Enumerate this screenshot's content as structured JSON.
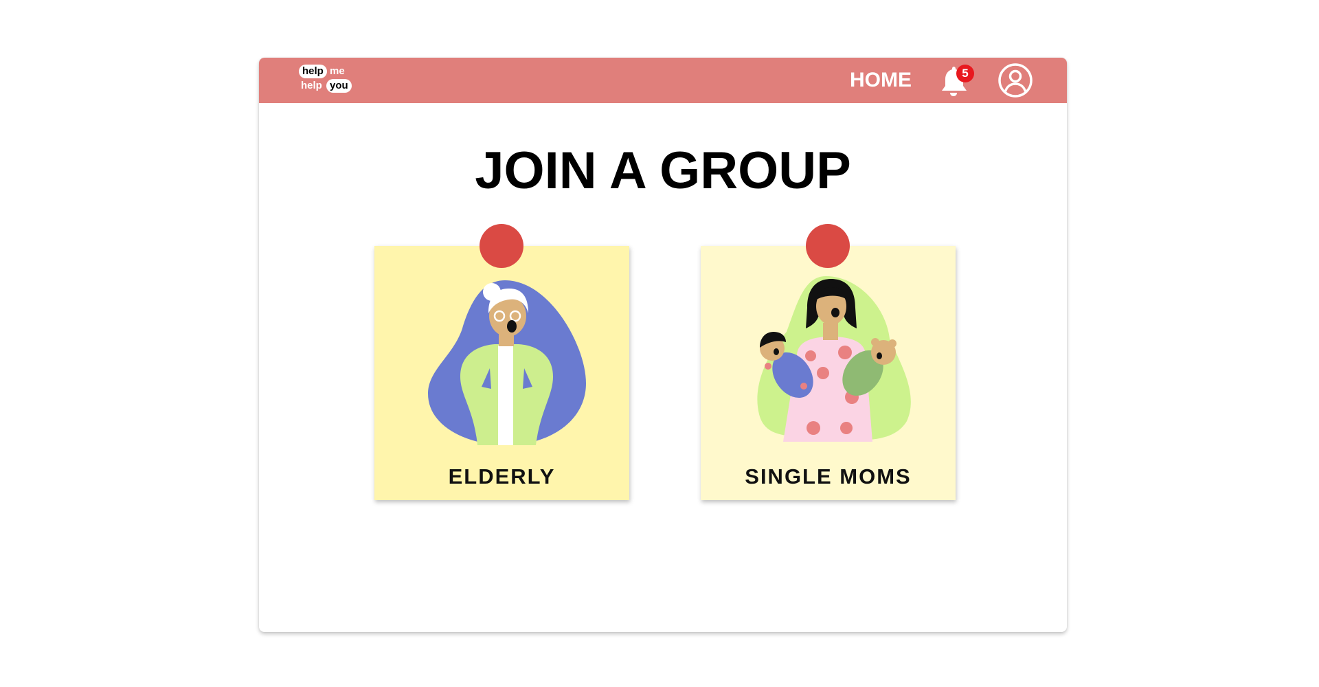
{
  "header": {
    "logo": {
      "word1": "help",
      "word2": "me",
      "word3": "help",
      "word4": "you"
    },
    "home_label": "HOME",
    "notifications": {
      "icon": "bell-icon",
      "count": "5"
    },
    "profile": {
      "icon": "user-circle-icon"
    }
  },
  "main": {
    "title": "JOIN A GROUP",
    "groups": [
      {
        "label": "ELDERLY",
        "pin_color": "#da4a44",
        "card_color": "#fff5ac"
      },
      {
        "label": "SINGLE MOMS",
        "pin_color": "#da4a44",
        "card_color": "#fff9cc"
      }
    ]
  },
  "colors": {
    "navbar": "#e07f7b",
    "badge": "#e8191f"
  }
}
